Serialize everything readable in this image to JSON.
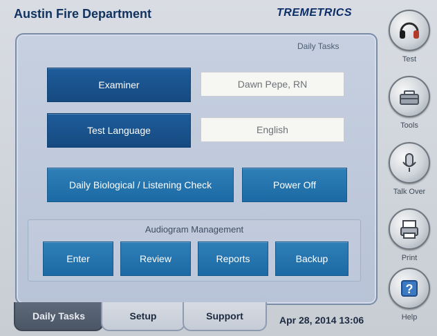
{
  "header": {
    "title": "Austin Fire Department",
    "logo_text": "TREMETRICS"
  },
  "panel": {
    "label": "Daily Tasks",
    "examiner_label": "Examiner",
    "examiner_value": "Dawn Pepe, RN",
    "test_language_label": "Test Language",
    "test_language_value": "English",
    "daily_check_label": "Daily Biological / Listening Check",
    "power_off_label": "Power Off",
    "audiogram_group": {
      "title": "Audiogram Management",
      "buttons": [
        "Enter",
        "Review",
        "Reports",
        "Backup"
      ]
    }
  },
  "sidebar": {
    "items": [
      {
        "label": "Test",
        "icon": "headphones-icon"
      },
      {
        "label": "Tools",
        "icon": "toolbox-icon"
      },
      {
        "label": "Talk Over",
        "icon": "microphone-icon"
      },
      {
        "label": "Print",
        "icon": "printer-icon"
      },
      {
        "label": "Help",
        "icon": "help-icon"
      }
    ]
  },
  "tabs": [
    "Daily Tasks",
    "Setup",
    "Support"
  ],
  "datetime": "Apr 28, 2014 13:06",
  "colors": {
    "accent": "#1c6aa5",
    "accent_dark": "#154a80",
    "panel_bg": "#c6d0e0",
    "title": "#11325f"
  }
}
